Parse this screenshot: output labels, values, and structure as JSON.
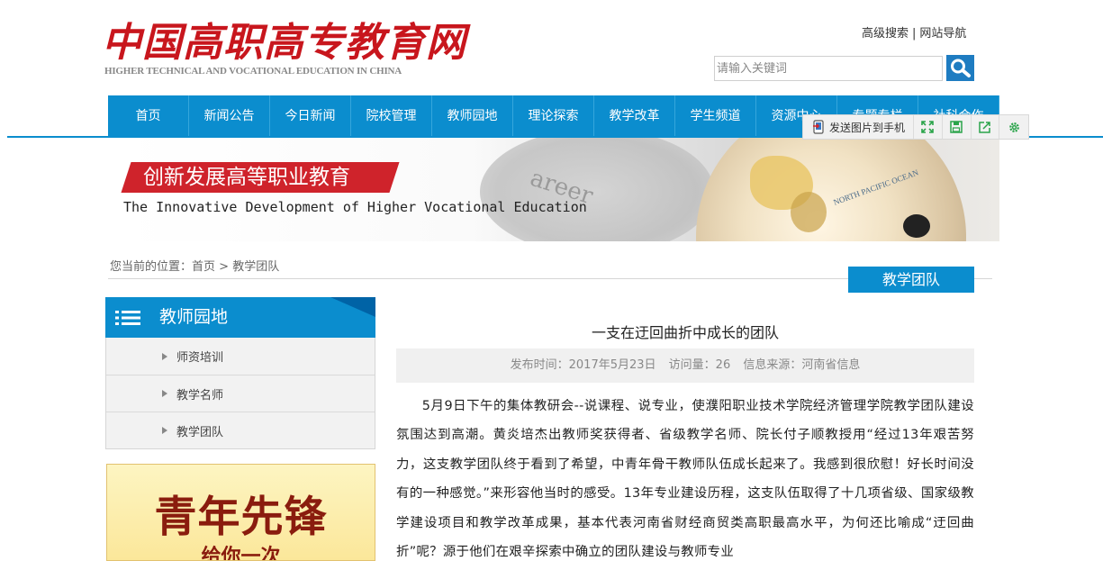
{
  "site": {
    "logo_cn": "中国高职高专教育网",
    "logo_en": "HIGHER TECHNICAL AND VOCATIONAL EDUCATION IN CHINA"
  },
  "top_links": {
    "advanced_search": "高级搜索",
    "separator": "|",
    "site_nav": "网站导航"
  },
  "search": {
    "placeholder": "请输入关键词"
  },
  "nav": {
    "items": [
      "首页",
      "新闻公告",
      "今日新闻",
      "院校管理",
      "教师园地",
      "理论探索",
      "教学改革",
      "学生频道",
      "资源中心",
      "专题专栏",
      "社科合作"
    ]
  },
  "toolbar": {
    "send_label": "发送图片到手机"
  },
  "banner": {
    "title": "创新发展高等职业教育",
    "subtitle": "The Innovative Development of Higher Vocational Education",
    "paper_word": "areer",
    "globe_label": "NORTH PACIFIC OCEAN"
  },
  "breadcrumb": {
    "prefix": "您当前的位置：",
    "home": "首页",
    "sep": " > ",
    "current": "教学团队"
  },
  "section_tab": "教学团队",
  "sidebar": {
    "title": "教师园地",
    "items": [
      "师资培训",
      "教学名师",
      "教学团队"
    ]
  },
  "promo": {
    "title": "青年先锋",
    "subtitle": "给你一次"
  },
  "article": {
    "title": "一支在迂回曲折中成长的团队",
    "publish_label": "发布时间：2017年5月23日",
    "views_label": "访问量：26",
    "source_label": "信息来源：河南省信息",
    "body": "5月9日下午的集体教研会--说课程、说专业，使濮阳职业技术学院经济管理学院教学团队建设氛围达到高潮。黄炎培杰出教师奖获得者、省级教学名师、院长付子顺教授用“经过13年艰苦努力，这支教学团队终于看到了希望，中青年骨干教师队伍成长起来了。我感到很欣慰！好长时间没有的一种感觉。”来形容他当时的感受。13年专业建设历程，这支队伍取得了十几项省级、国家级教学建设项目和教学改革成果，基本代表河南省财经商贸类高职最高水平，为何还比喻成“迂回曲折”呢？源于他们在艰辛探索中确立的团队建设与教师专业"
  },
  "colors": {
    "brand_blue": "#0b8dce",
    "logo_red": "#c8161d",
    "banner_red": "#cf232b"
  }
}
